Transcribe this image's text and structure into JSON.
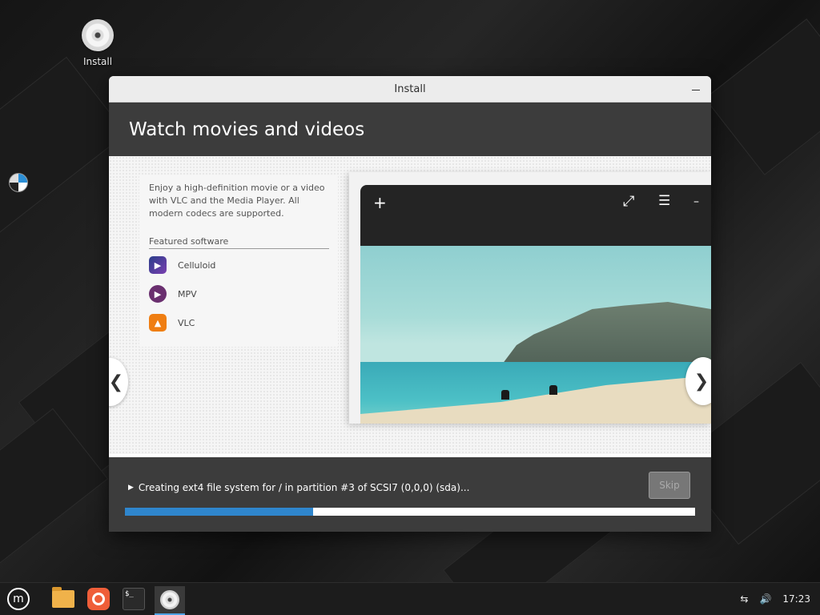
{
  "desktop": {
    "install_icon_label": "Install"
  },
  "window": {
    "title": "Install",
    "header": "Watch movies and videos",
    "description": "Enjoy a high-definition movie or a video with VLC and the Media Player. All modern codecs are supported.",
    "featured_title": "Featured software",
    "apps": [
      "Celluloid",
      "MPV",
      "VLC"
    ],
    "nav_left": "❮",
    "nav_right": "❯",
    "player": {
      "add": "+",
      "fullscreen": "⤢",
      "menu": "☰",
      "minimize": "–"
    }
  },
  "footer": {
    "status": "Creating ext4 file system for / in partition #3 of SCSI7 (0,0,0) (sda)...",
    "skip_label": "Skip",
    "progress_fraction": 0.33
  },
  "taskbar": {
    "clock": "17:23",
    "terminal_text": "$_"
  },
  "colors": {
    "progress": "#2f86cd",
    "header_bg": "#3c3c3c"
  }
}
